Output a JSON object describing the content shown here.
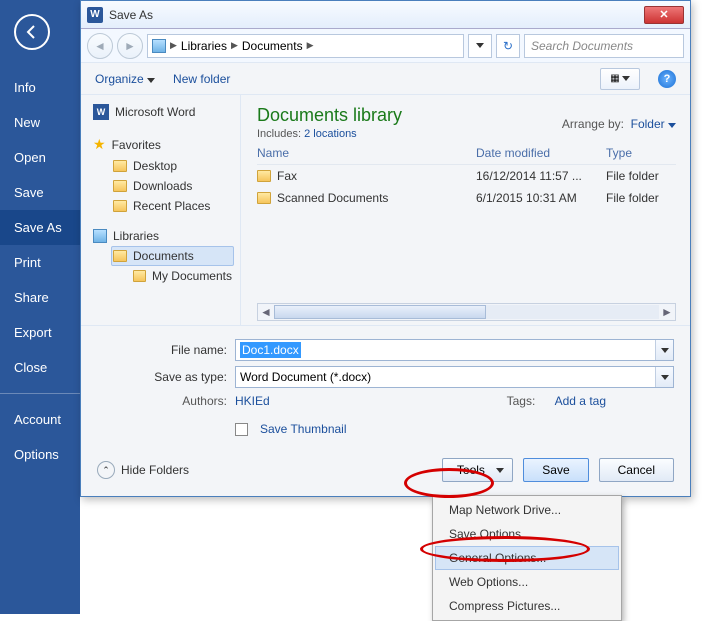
{
  "sidebar": {
    "items": [
      {
        "label": "Info"
      },
      {
        "label": "New"
      },
      {
        "label": "Open"
      },
      {
        "label": "Save"
      },
      {
        "label": "Save As"
      },
      {
        "label": "Print"
      },
      {
        "label": "Share"
      },
      {
        "label": "Export"
      },
      {
        "label": "Close"
      }
    ],
    "lower": [
      {
        "label": "Account"
      },
      {
        "label": "Options"
      }
    ]
  },
  "dialog": {
    "title": "Save As",
    "breadcrumb": [
      "Libraries",
      "Documents"
    ],
    "search_placeholder": "Search Documents",
    "toolbar": {
      "organize": "Organize",
      "newfolder": "New folder"
    },
    "library": {
      "title": "Documents library",
      "includes_prefix": "Includes:",
      "includes_link": "2 locations",
      "arrange_label": "Arrange by:",
      "arrange_value": "Folder"
    },
    "columns": {
      "name": "Name",
      "date": "Date modified",
      "type": "Type"
    },
    "files": [
      {
        "name": "Fax",
        "date": "16/12/2014 11:57 ...",
        "type": "File folder"
      },
      {
        "name": "Scanned Documents",
        "date": "6/1/2015 10:31 AM",
        "type": "File folder"
      }
    ],
    "tree": {
      "msword": "Microsoft Word",
      "favorites": "Favorites",
      "fav_items": [
        "Desktop",
        "Downloads",
        "Recent Places"
      ],
      "libraries": "Libraries",
      "documents": "Documents",
      "mydocs": "My Documents"
    },
    "form": {
      "filename_label": "File name:",
      "filename_value": "Doc1.docx",
      "savetype_label": "Save as type:",
      "savetype_value": "Word Document (*.docx)",
      "authors_label": "Authors:",
      "authors_value": "HKIEd",
      "tags_label": "Tags:",
      "tags_value": "Add a tag",
      "thumb": "Save Thumbnail"
    },
    "actions": {
      "hide": "Hide Folders",
      "tools": "Tools",
      "save": "Save",
      "cancel": "Cancel"
    },
    "tools_menu": [
      "Map Network Drive...",
      "Save Options...",
      "General Options...",
      "Web Options...",
      "Compress Pictures..."
    ]
  }
}
